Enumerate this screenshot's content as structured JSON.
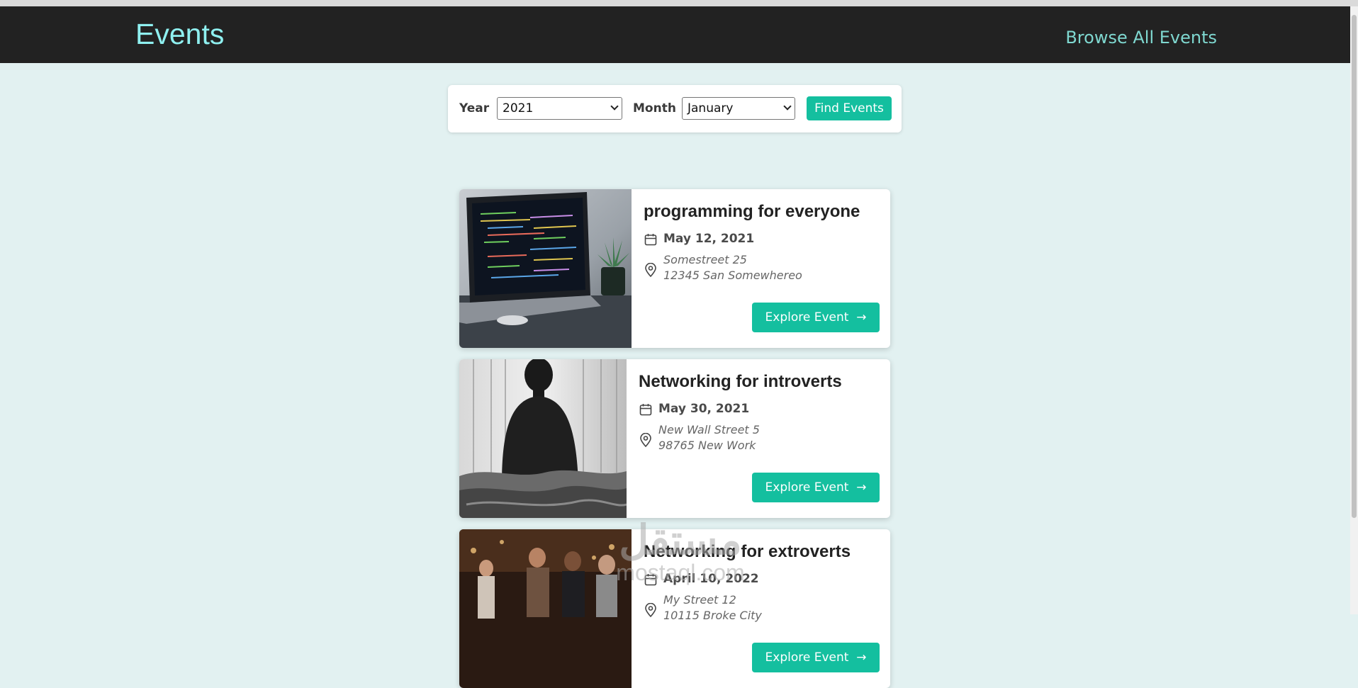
{
  "header": {
    "logo": "Events",
    "nav_link": "Browse All Events"
  },
  "filter": {
    "year_label": "Year",
    "year_value": "2021",
    "month_label": "Month",
    "month_value": "January",
    "find_button": "Find Events"
  },
  "events": [
    {
      "title": "programming for everyone",
      "date": "May 12, 2021",
      "address_line1": "Somestreet 25",
      "address_line2": "12345 San Somewhereo",
      "button": "Explore Event"
    },
    {
      "title": "Networking for introverts",
      "date": "May 30, 2021",
      "address_line1": "New Wall Street 5",
      "address_line2": "98765 New Work",
      "button": "Explore Event"
    },
    {
      "title": "Networking for extroverts",
      "date": "April 10, 2022",
      "address_line1": "My Street 12",
      "address_line2": "10115 Broke City",
      "button": "Explore Event"
    }
  ],
  "watermark": {
    "arabic": "مستقل",
    "latin": "mostaql.com"
  },
  "colors": {
    "accent": "#14bf9f",
    "header_bg": "#222222",
    "logo": "#8ff0f0",
    "page_bg": "#e2f1f1"
  },
  "icons": [
    "calendar-icon",
    "location-pin-icon",
    "arrow-right-icon",
    "chevron-down-icon"
  ]
}
